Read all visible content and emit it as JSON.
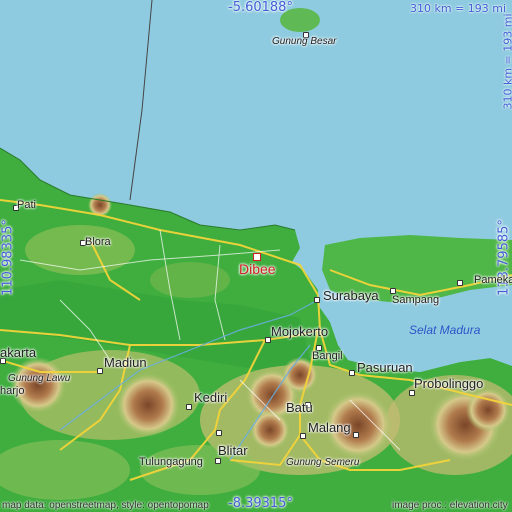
{
  "coords": {
    "top": "-5.60188°",
    "bottom": "-8.39315°",
    "left": "110.98335°",
    "right": "113.79585°"
  },
  "scale": {
    "horizontal": "310 km = 193 mi",
    "vertical": "310 km = 193 mi"
  },
  "credits": {
    "left": "map data: openstreetmap, style: opentopomap",
    "right": "image proc.: elevation.city"
  },
  "main_place": "Dibee",
  "places": {
    "gunung_besar": "Gunung Besar",
    "pati": "Pati",
    "blora": "Blora",
    "surabaya": "Surabaya",
    "pamekasan": "Pameka",
    "sampang": "Sampang",
    "bangil": "Bangil",
    "mojokerto": "Mojokerto",
    "selat_madura": "Selat Madura",
    "pasuruan": "Pasuruan",
    "probolinggo": "Probolinggo",
    "surakarta": "akarta",
    "madiun": "Madiun",
    "gunung_lawu": "Gunung Lawu",
    "sukoharjo": "harjo",
    "kediri": "Kediri",
    "batu": "Batu",
    "malang": "Malang",
    "blitar": "Blitar",
    "tulungagung": "Tulungagung",
    "gunung_semeru": "Gunung Semeru"
  },
  "colors": {
    "sea": "#8fcbe0",
    "lowland": "#3fae3f",
    "hills": "#c9c37a",
    "mountain": "#8a5a36",
    "label_blue": "#3f5fd6",
    "marker_red": "#d02020"
  }
}
